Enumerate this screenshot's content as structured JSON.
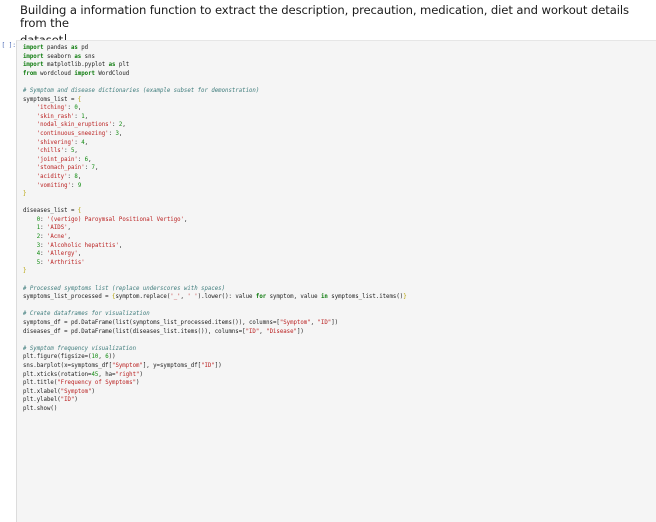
{
  "markdown": {
    "line1": "Building a information function to extract the description, precaution, medication, diet and workout details from the",
    "line2": "dataset"
  },
  "code_cell": {
    "prompt": "[ ]:",
    "lines": [
      [
        {
          "t": "kw",
          "v": "import"
        },
        {
          "t": "plain",
          "v": " pandas "
        },
        {
          "t": "kw",
          "v": "as"
        },
        {
          "t": "plain",
          "v": " pd"
        }
      ],
      [
        {
          "t": "kw",
          "v": "import"
        },
        {
          "t": "plain",
          "v": " seaborn "
        },
        {
          "t": "kw",
          "v": "as"
        },
        {
          "t": "plain",
          "v": " sns"
        }
      ],
      [
        {
          "t": "kw",
          "v": "import"
        },
        {
          "t": "plain",
          "v": " matplotlib.pyplot "
        },
        {
          "t": "kw",
          "v": "as"
        },
        {
          "t": "plain",
          "v": " plt"
        }
      ],
      [
        {
          "t": "kw",
          "v": "from"
        },
        {
          "t": "plain",
          "v": " wordcloud "
        },
        {
          "t": "kw",
          "v": "import"
        },
        {
          "t": "plain",
          "v": " WordCloud"
        }
      ],
      [],
      [
        {
          "t": "com",
          "v": "# Symptom and disease dictionaries (example subset for demonstration)"
        }
      ],
      [
        {
          "t": "plain",
          "v": "symptoms_list = "
        },
        {
          "t": "brace",
          "v": "{"
        }
      ],
      [
        {
          "t": "plain",
          "v": "    "
        },
        {
          "t": "str",
          "v": "'itching'"
        },
        {
          "t": "plain",
          "v": ": "
        },
        {
          "t": "num",
          "v": "0"
        },
        {
          "t": "plain",
          "v": ","
        }
      ],
      [
        {
          "t": "plain",
          "v": "    "
        },
        {
          "t": "str",
          "v": "'skin_rash'"
        },
        {
          "t": "plain",
          "v": ": "
        },
        {
          "t": "num",
          "v": "1"
        },
        {
          "t": "plain",
          "v": ","
        }
      ],
      [
        {
          "t": "plain",
          "v": "    "
        },
        {
          "t": "str",
          "v": "'nodal_skin_eruptions'"
        },
        {
          "t": "plain",
          "v": ": "
        },
        {
          "t": "num",
          "v": "2"
        },
        {
          "t": "plain",
          "v": ","
        }
      ],
      [
        {
          "t": "plain",
          "v": "    "
        },
        {
          "t": "str",
          "v": "'continuous_sneezing'"
        },
        {
          "t": "plain",
          "v": ": "
        },
        {
          "t": "num",
          "v": "3"
        },
        {
          "t": "plain",
          "v": ","
        }
      ],
      [
        {
          "t": "plain",
          "v": "    "
        },
        {
          "t": "str",
          "v": "'shivering'"
        },
        {
          "t": "plain",
          "v": ": "
        },
        {
          "t": "num",
          "v": "4"
        },
        {
          "t": "plain",
          "v": ","
        }
      ],
      [
        {
          "t": "plain",
          "v": "    "
        },
        {
          "t": "str",
          "v": "'chills'"
        },
        {
          "t": "plain",
          "v": ": "
        },
        {
          "t": "num",
          "v": "5"
        },
        {
          "t": "plain",
          "v": ","
        }
      ],
      [
        {
          "t": "plain",
          "v": "    "
        },
        {
          "t": "str",
          "v": "'joint_pain'"
        },
        {
          "t": "plain",
          "v": ": "
        },
        {
          "t": "num",
          "v": "6"
        },
        {
          "t": "plain",
          "v": ","
        }
      ],
      [
        {
          "t": "plain",
          "v": "    "
        },
        {
          "t": "str",
          "v": "'stomach_pain'"
        },
        {
          "t": "plain",
          "v": ": "
        },
        {
          "t": "num",
          "v": "7"
        },
        {
          "t": "plain",
          "v": ","
        }
      ],
      [
        {
          "t": "plain",
          "v": "    "
        },
        {
          "t": "str",
          "v": "'acidity'"
        },
        {
          "t": "plain",
          "v": ": "
        },
        {
          "t": "num",
          "v": "8"
        },
        {
          "t": "plain",
          "v": ","
        }
      ],
      [
        {
          "t": "plain",
          "v": "    "
        },
        {
          "t": "str",
          "v": "'vomiting'"
        },
        {
          "t": "plain",
          "v": ": "
        },
        {
          "t": "num",
          "v": "9"
        }
      ],
      [
        {
          "t": "brace",
          "v": "}"
        }
      ],
      [],
      [
        {
          "t": "plain",
          "v": "diseases_list = "
        },
        {
          "t": "brace",
          "v": "{"
        }
      ],
      [
        {
          "t": "plain",
          "v": "    "
        },
        {
          "t": "num",
          "v": "0"
        },
        {
          "t": "plain",
          "v": ": "
        },
        {
          "t": "str",
          "v": "'(vertigo) Paroymsal Positional Vertigo'"
        },
        {
          "t": "plain",
          "v": ","
        }
      ],
      [
        {
          "t": "plain",
          "v": "    "
        },
        {
          "t": "num",
          "v": "1"
        },
        {
          "t": "plain",
          "v": ": "
        },
        {
          "t": "str",
          "v": "'AIDS'"
        },
        {
          "t": "plain",
          "v": ","
        }
      ],
      [
        {
          "t": "plain",
          "v": "    "
        },
        {
          "t": "num",
          "v": "2"
        },
        {
          "t": "plain",
          "v": ": "
        },
        {
          "t": "str",
          "v": "'Acne'"
        },
        {
          "t": "plain",
          "v": ","
        }
      ],
      [
        {
          "t": "plain",
          "v": "    "
        },
        {
          "t": "num",
          "v": "3"
        },
        {
          "t": "plain",
          "v": ": "
        },
        {
          "t": "str",
          "v": "'Alcoholic hepatitis'"
        },
        {
          "t": "plain",
          "v": ","
        }
      ],
      [
        {
          "t": "plain",
          "v": "    "
        },
        {
          "t": "num",
          "v": "4"
        },
        {
          "t": "plain",
          "v": ": "
        },
        {
          "t": "str",
          "v": "'Allergy'"
        },
        {
          "t": "plain",
          "v": ","
        }
      ],
      [
        {
          "t": "plain",
          "v": "    "
        },
        {
          "t": "num",
          "v": "5"
        },
        {
          "t": "plain",
          "v": ": "
        },
        {
          "t": "str",
          "v": "'Arthritis'"
        }
      ],
      [
        {
          "t": "brace",
          "v": "}"
        }
      ],
      [],
      [
        {
          "t": "com",
          "v": "# Processed symptoms list (replace underscores with spaces)"
        }
      ],
      [
        {
          "t": "plain",
          "v": "symptoms_list_processed = "
        },
        {
          "t": "brace",
          "v": "{"
        },
        {
          "t": "plain",
          "v": "symptom.replace("
        },
        {
          "t": "str",
          "v": "'_'"
        },
        {
          "t": "plain",
          "v": ", "
        },
        {
          "t": "str",
          "v": "' '"
        },
        {
          "t": "plain",
          "v": ").lower(): value "
        },
        {
          "t": "kw",
          "v": "for"
        },
        {
          "t": "plain",
          "v": " symptom, value "
        },
        {
          "t": "kw",
          "v": "in"
        },
        {
          "t": "plain",
          "v": " symptoms_list.items()"
        },
        {
          "t": "brace",
          "v": "}"
        }
      ],
      [],
      [
        {
          "t": "com",
          "v": "# Create dataframes for visualization"
        }
      ],
      [
        {
          "t": "plain",
          "v": "symptoms_df = pd.DataFrame(list(symptoms_list_processed.items()), columns=["
        },
        {
          "t": "str",
          "v": "\"Symptom\""
        },
        {
          "t": "plain",
          "v": ", "
        },
        {
          "t": "str",
          "v": "\"ID\""
        },
        {
          "t": "plain",
          "v": "])"
        }
      ],
      [
        {
          "t": "plain",
          "v": "diseases_df = pd.DataFrame(list(diseases_list.items()), columns=["
        },
        {
          "t": "str",
          "v": "\"ID\""
        },
        {
          "t": "plain",
          "v": ", "
        },
        {
          "t": "str",
          "v": "\"Disease\""
        },
        {
          "t": "plain",
          "v": "])"
        }
      ],
      [],
      [
        {
          "t": "com",
          "v": "# Symptom frequency visualization"
        }
      ],
      [
        {
          "t": "plain",
          "v": "plt.figure(figsize=("
        },
        {
          "t": "num",
          "v": "10"
        },
        {
          "t": "plain",
          "v": ", "
        },
        {
          "t": "num",
          "v": "6"
        },
        {
          "t": "plain",
          "v": "))"
        }
      ],
      [
        {
          "t": "plain",
          "v": "sns.barplot(x=symptoms_df["
        },
        {
          "t": "str",
          "v": "\"Symptom\""
        },
        {
          "t": "plain",
          "v": "], y=symptoms_df["
        },
        {
          "t": "str",
          "v": "\"ID\""
        },
        {
          "t": "plain",
          "v": "])"
        }
      ],
      [
        {
          "t": "plain",
          "v": "plt.xticks(rotation="
        },
        {
          "t": "num",
          "v": "45"
        },
        {
          "t": "plain",
          "v": ", ha="
        },
        {
          "t": "str",
          "v": "\"right\""
        },
        {
          "t": "plain",
          "v": ")"
        }
      ],
      [
        {
          "t": "plain",
          "v": "plt.title("
        },
        {
          "t": "str",
          "v": "\"Frequency of Symptoms\""
        },
        {
          "t": "plain",
          "v": ")"
        }
      ],
      [
        {
          "t": "plain",
          "v": "plt.xlabel("
        },
        {
          "t": "str",
          "v": "\"Symptom\""
        },
        {
          "t": "plain",
          "v": ")"
        }
      ],
      [
        {
          "t": "plain",
          "v": "plt.ylabel("
        },
        {
          "t": "str",
          "v": "\"ID\""
        },
        {
          "t": "plain",
          "v": ")"
        }
      ],
      [
        {
          "t": "plain",
          "v": "plt.show()"
        }
      ]
    ]
  },
  "colors": {
    "keyword": "#0b7a0b",
    "string": "#ba2121",
    "number": "#0f8a0f",
    "comment": "#3d7b7b",
    "brace": "#b5a100",
    "cell_background": "#f5f5f5"
  }
}
